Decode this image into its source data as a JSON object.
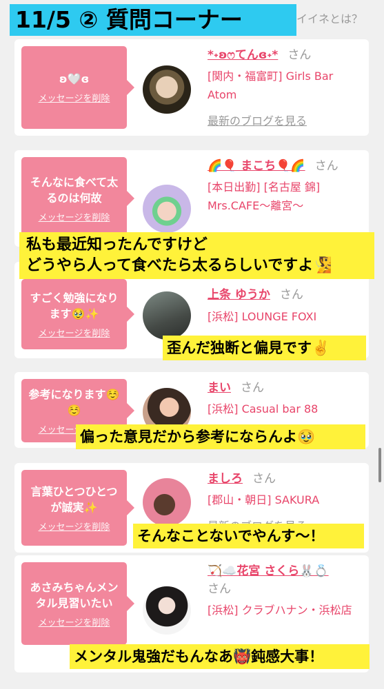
{
  "header": {
    "title": "11/5 ② 質問コーナー",
    "link": "イイネとは？"
  },
  "cards": [
    {
      "message": "ʚ🤍ɞ",
      "delete_label": "メッセージを削除",
      "name": "*˖ʚෆてんɞ˖*",
      "san": "さん",
      "shop": "[関内・福富町] Girls Bar Atom",
      "blog_link": "最新のブログを見る"
    },
    {
      "message": "そんなに食べて太るのは何故",
      "delete_label": "メッセージを削除",
      "name": "🌈🎈 まこち🎈🌈",
      "san": "さん",
      "shop": "[本日出勤] [名古屋 錦] Mrs.CAFE〜離宮〜"
    },
    {
      "message": "すごく勉強になります🥹✨",
      "delete_label": "メッセージを削除",
      "name": "上条 ゆうか",
      "san": "さん",
      "shop": "[浜松] LOUNGE FOXI"
    },
    {
      "message": "参考になります☺️ ☺️",
      "delete_label": "メッセージを削除",
      "name": "まい",
      "san": "さん",
      "shop": "[浜松] Casual bar 88"
    },
    {
      "message": "言葉ひとつひとつが誠実✨",
      "delete_label": "メッセージを削除",
      "name": "ましろ",
      "san": "さん",
      "shop": "[郡山・朝日] SAKURA",
      "blog_link": "最新のブログを見る"
    },
    {
      "message": "あさみちゃんメンタル見習いたい",
      "delete_label": "メッセージを削除",
      "name": "🏹☁️花宮 さくら🐰💍",
      "san": "さん",
      "shop": "[浜松] クラブハナン・浜松店"
    }
  ],
  "overlays": {
    "o1_line1": "私も最近知ったんですけど",
    "o1_line2": "どうやら人って食べたら太るらしいですよ🧏",
    "o2": "歪んだ独断と偏見です✌️",
    "o3": "偏った意見だから参考にならんよ🥹",
    "o4": "そんなことないでやんす〜！",
    "o5": "メンタル鬼強だもんなあ👹鈍感大事！"
  },
  "colors": {
    "title_bg": "#2ecaf0",
    "message_bg": "#f2879c",
    "name_color": "#e8456a",
    "overlay_bg": "#fff23a"
  }
}
